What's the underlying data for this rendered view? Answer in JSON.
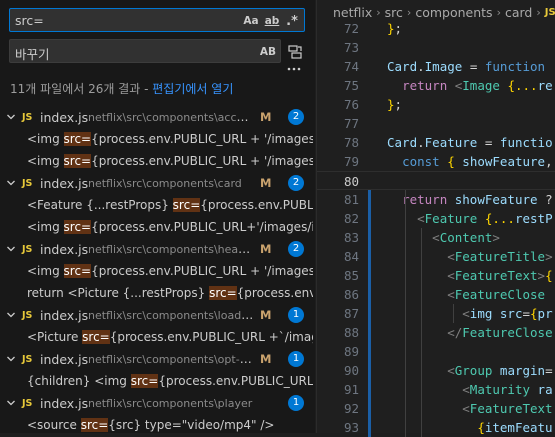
{
  "search": {
    "query": "src=",
    "replace": "바꾸기",
    "opt_case": "Aa",
    "opt_word": "ab",
    "opt_regex": ".*",
    "opt_preserve_case": "AB",
    "summary_prefix": "11개 파일에서 26개 결과 - ",
    "summary_link": "편집기에서 열기",
    "results": [
      {
        "file": "index.js",
        "path": "netflix\\src\\components\\accor...",
        "status": "M",
        "count": "2",
        "matches": [
          {
            "pre": "<img ",
            "hl": "src=",
            "post": "{process.env.PUBLIC_URL + '/images/i..."
          },
          {
            "pre": "<img ",
            "hl": "src=",
            "post": "{process.env.PUBLIC_URL + '/images/i..."
          }
        ]
      },
      {
        "file": "index.js",
        "path": "netflix\\src\\components\\card",
        "status": "M",
        "count": "2",
        "matches": [
          {
            "pre": "<Feature {...restProps} ",
            "hl": "src=",
            "post": "{process.env.PUBLIC..."
          },
          {
            "pre": "<img ",
            "hl": "src=",
            "post": "{process.env.PUBLIC_URL+'/images/ic..."
          }
        ]
      },
      {
        "file": "index.js",
        "path": "netflix\\src\\components\\header",
        "status": "M",
        "count": "2",
        "matches": [
          {
            "pre": "<img ",
            "hl": "src=",
            "post": "{process.env.PUBLIC_URL + '/images/i..."
          },
          {
            "pre": "return <Picture {...restProps} ",
            "hl": "src=",
            "post": "{process.env.PU..."
          }
        ]
      },
      {
        "file": "index.js",
        "path": "netflix\\src\\components\\loading",
        "status": "M",
        "count": "1",
        "matches": [
          {
            "pre": "<Picture ",
            "hl": "src=",
            "post": "{process.env.PUBLIC_URL +`/images/i..."
          }
        ]
      },
      {
        "file": "index.js",
        "path": "netflix\\src\\components\\opt-fo...",
        "status": "M",
        "count": "1",
        "matches": [
          {
            "pre": "{children} <img ",
            "hl": "src=",
            "post": "{process.env.PUBLIC_URL +\"..."
          }
        ]
      },
      {
        "file": "index.js",
        "path": "netflix\\src\\components\\player",
        "status": "",
        "count": "1",
        "matches": [
          {
            "pre": "<source ",
            "hl": "src=",
            "post": "{src} type=\"video/mp4\" />"
          }
        ]
      }
    ]
  },
  "editor": {
    "breadcrumb": [
      "netflix",
      "src",
      "components",
      "card",
      "JS"
    ],
    "lines": [
      {
        "n": "72",
        "text": "};"
      },
      {
        "n": "73",
        "text": ""
      },
      {
        "n": "74",
        "text": "Card.Image = function"
      },
      {
        "n": "75",
        "text": "  return <Image {...re"
      },
      {
        "n": "76",
        "text": "};"
      },
      {
        "n": "77",
        "text": ""
      },
      {
        "n": "78",
        "text": "Card.Feature = functio"
      },
      {
        "n": "79",
        "text": "  const { showFeature,"
      },
      {
        "n": "80",
        "text": ""
      },
      {
        "n": "81",
        "text": "  return showFeature ?"
      },
      {
        "n": "82",
        "text": "    <Feature {...restP"
      },
      {
        "n": "83",
        "text": "      <Content>"
      },
      {
        "n": "84",
        "text": "        <FeatureTitle>"
      },
      {
        "n": "85",
        "text": "        <FeatureText>{"
      },
      {
        "n": "86",
        "text": "        <FeatureClose"
      },
      {
        "n": "87",
        "text": "          <img src={pr"
      },
      {
        "n": "88",
        "text": "        </FeatureClose"
      },
      {
        "n": "89",
        "text": ""
      },
      {
        "n": "90",
        "text": "        <Group margin="
      },
      {
        "n": "91",
        "text": "          <Maturity ra"
      },
      {
        "n": "92",
        "text": "          <FeatureText"
      },
      {
        "n": "93",
        "text": "            {itemFeatu"
      }
    ],
    "current_line": "80"
  },
  "colors": {
    "accent": "#0078d4",
    "match_highlight": "#613214",
    "js_badge": "#e8c93a",
    "modified": "#c9a26d"
  },
  "icons": [
    "chevron-down-icon",
    "replace-all-icon",
    "more-icon",
    "js-file-icon"
  ]
}
